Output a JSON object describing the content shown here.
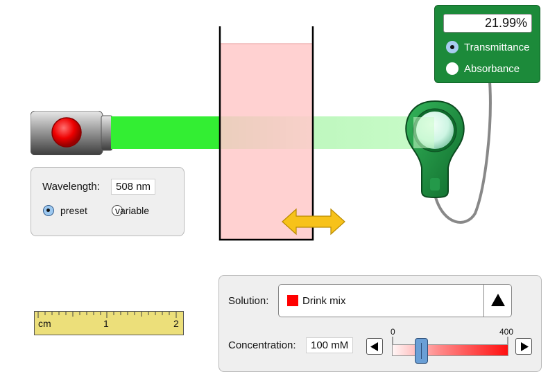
{
  "wavelength": {
    "label": "Wavelength:",
    "value": "508 nm",
    "options": [
      {
        "label": "preset",
        "selected": true
      },
      {
        "label": "variable",
        "selected": false
      }
    ]
  },
  "detector": {
    "readout": "21.99%",
    "modes": [
      {
        "label": "Transmittance",
        "selected": true
      },
      {
        "label": "Absorbance",
        "selected": false
      }
    ]
  },
  "ruler": {
    "unit": "cm",
    "ticks": [
      "1",
      "2"
    ]
  },
  "solution": {
    "label": "Solution:",
    "selected": "Drink mix",
    "swatch_color": "#ff0000"
  },
  "concentration": {
    "label": "Concentration:",
    "value": "100 mM",
    "slider_min": "0",
    "slider_max": "400",
    "slider_level": 0.25
  },
  "colors": {
    "beam": "#33ee33",
    "solution_fill": "#ffcccc",
    "meter_body": "#1c8a3a",
    "arrow": "#f7c21a"
  }
}
